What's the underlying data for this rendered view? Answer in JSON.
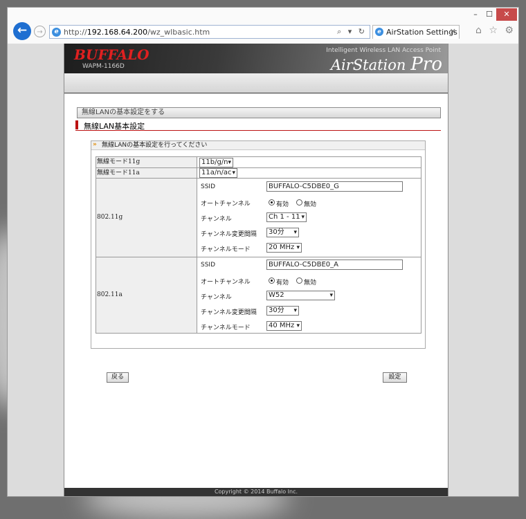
{
  "browser": {
    "url_prefix": "http://",
    "url_host": "192.168.64.200",
    "url_path": "/wz_wlbasic.htm",
    "url_tools": "⌕ ▾ ↻",
    "tab_title": "AirStation Settings",
    "tab_close": "✕",
    "win_min": "–",
    "win_max": "☐",
    "win_close": "✕",
    "toolbar_icons": "⌂ ☆ ⚙"
  },
  "header": {
    "brand": "BUFFALO",
    "model": "WAPM-1166D",
    "tagline": "Intelligent Wireless LAN Access Point",
    "product": "AirStation",
    "product_suffix": "Pro"
  },
  "breadcrumb": "無線LANの基本設定をする",
  "section_title": "無線LAN基本設定",
  "panel": {
    "heading": "無線LANの基本設定を行ってください",
    "mode11g_label": "無線モード11g",
    "mode11g_value": "11b/g/n",
    "mode11a_label": "無線モード11a",
    "mode11a_value": "11a/n/ac",
    "g_band": {
      "label": "802.11g",
      "ssid_label": "SSID",
      "ssid": "BUFFALO-C5DBE0_G",
      "auto_label": "オートチャンネル",
      "auto_on": "有効",
      "auto_off": "無効",
      "channel_label": "チャンネル",
      "channel": "Ch 1 - 11",
      "interval_label": "チャンネル変更間隔",
      "interval": "30分",
      "mode_label": "チャンネルモード",
      "mode": "20 MHz"
    },
    "a_band": {
      "label": "802.11a",
      "ssid_label": "SSID",
      "ssid": "BUFFALO-C5DBE0_A",
      "auto_label": "オートチャンネル",
      "auto_on": "有効",
      "auto_off": "無効",
      "channel_label": "チャンネル",
      "channel": "W52",
      "interval_label": "チャンネル変更間隔",
      "interval": "30分",
      "mode_label": "チャンネルモード",
      "mode": "40 MHz"
    }
  },
  "buttons": {
    "back": "戻る",
    "submit": "設定"
  },
  "footer": "Copyright © 2014 Buffalo Inc."
}
